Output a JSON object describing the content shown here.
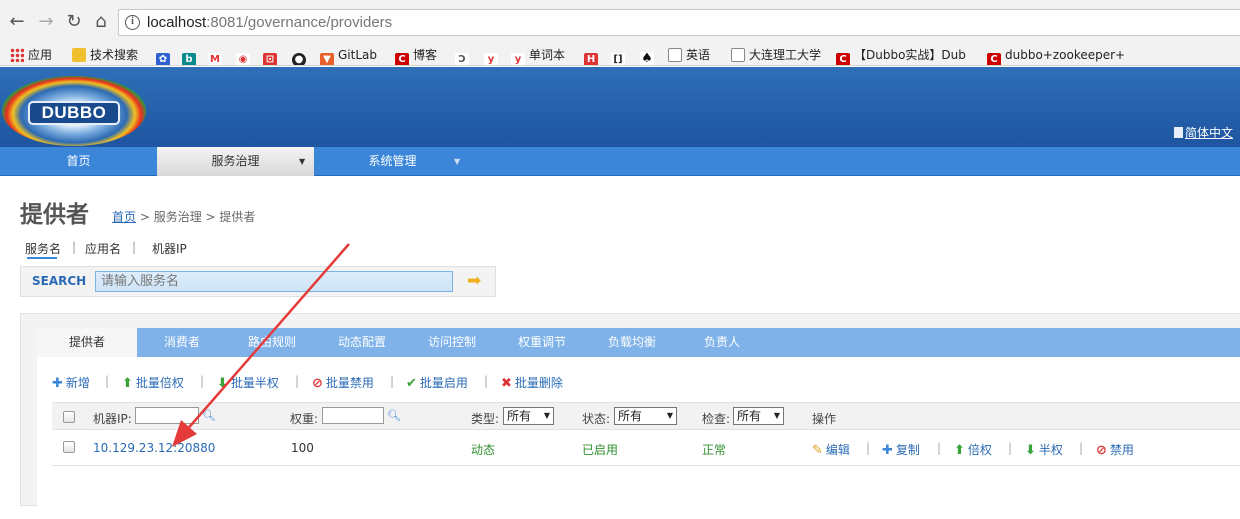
{
  "browser": {
    "url_host": "localhost",
    "url_rest": ":8081/governance/providers",
    "bookmarks": [
      "应用",
      "技术搜索",
      "GitLab",
      "博客",
      "单词本",
      "英语",
      "大连理工大学",
      "【Dubbo实战】Dub",
      "dubbo+zookeeper+"
    ]
  },
  "header": {
    "logo_text": "DUBBO",
    "lang_link": "简体中文"
  },
  "menu": {
    "items": [
      "首页",
      "服务治理",
      "系统管理"
    ]
  },
  "page": {
    "title": "提供者",
    "breadcrumb": {
      "home": "首页",
      "path": " > 服务治理 > 提供者"
    }
  },
  "search": {
    "tabs": [
      "服务名",
      "应用名",
      "机器IP"
    ],
    "label": "SEARCH",
    "placeholder": "请输入服务名"
  },
  "tabs": [
    "提供者",
    "消费者",
    "路由规则",
    "动态配置",
    "访问控制",
    "权重调节",
    "负载均衡",
    "负责人"
  ],
  "actions": [
    "新增",
    "批量倍权",
    "批量半权",
    "批量禁用",
    "批量启用",
    "批量删除"
  ],
  "table": {
    "headers": {
      "ip": "机器IP:",
      "weight": "权重:",
      "type": "类型:",
      "status": "状态:",
      "check": "检查:",
      "ops": "操作"
    },
    "filters": {
      "type": "所有",
      "status": "所有",
      "check": "所有"
    },
    "rows": [
      {
        "ip": "10.129.23.12:20880",
        "weight": "100",
        "type": "动态",
        "status": "已启用",
        "check": "正常"
      }
    ],
    "row_ops": [
      "编辑",
      "复制",
      "倍权",
      "半权",
      "禁用"
    ]
  },
  "colors": {
    "header_blue": "#1d55a0",
    "menu_blue": "#3b86d9",
    "tab_blue": "#7fb2e8",
    "link_blue": "#2a6ab5",
    "ok_green": "#2f8f2f",
    "annotation_red": "#e53a3a"
  }
}
